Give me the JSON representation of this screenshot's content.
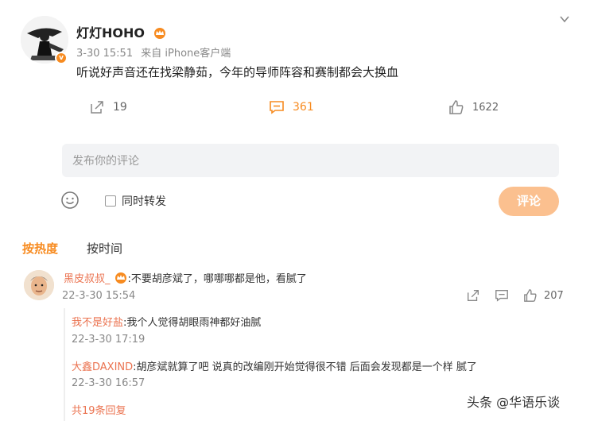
{
  "post": {
    "author": "灯灯HOHO",
    "time": "3-30 15:51",
    "source": "来自 iPhone客户端",
    "text": "听说好声音还在找梁静茹，今年的导师阵容和赛制都会大换血",
    "share_count": "19",
    "comment_count": "361",
    "like_count": "1622"
  },
  "composer": {
    "placeholder": "发布你的评论",
    "repost_label": "同时转发",
    "submit_label": "评论"
  },
  "sort": {
    "hot_label": "按热度",
    "time_label": "按时间"
  },
  "comment": {
    "user": "黑皮叔叔_",
    "text": ":不要胡彦斌了，哪哪哪都是他，看腻了",
    "time": "22-3-30 15:54",
    "like_count": "207",
    "replies": [
      {
        "user": "我不是好盐",
        "text": ":我个人觉得胡眼雨神都好油腻",
        "time": "22-3-30 17:19"
      },
      {
        "user": "大鑫DAXIND",
        "text": ":胡彦斌就算了吧  说真的改编刚开始觉得很不错  后面会发现都是一个样 腻了",
        "time": "22-3-30 16:57"
      }
    ],
    "more_replies": "共19条回复"
  },
  "watermark": "头条 @华语乐谈",
  "colors": {
    "accent": "#f78b20",
    "username": "#eb7350",
    "button_disabled": "#fbc08f",
    "input_bg": "#f2f3f5"
  },
  "icons": [
    "chevron-down-icon",
    "share-icon",
    "comment-icon",
    "like-icon",
    "emoji-icon",
    "crown-badge-icon",
    "verified-badge-icon"
  ]
}
